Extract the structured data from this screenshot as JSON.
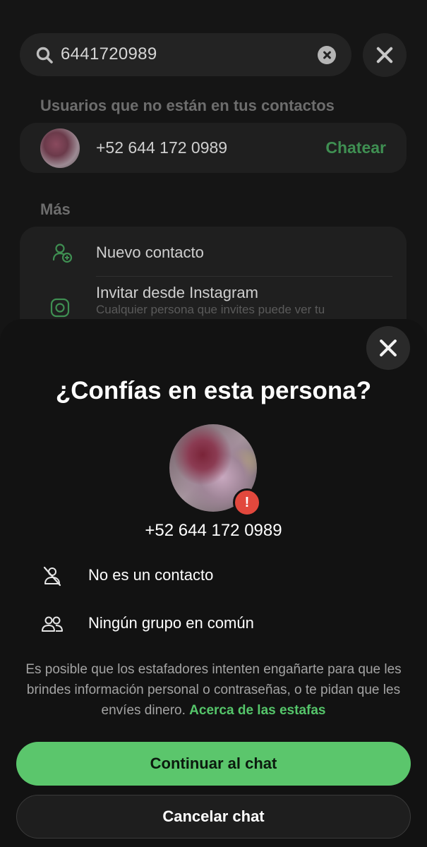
{
  "search": {
    "value": "6441720989"
  },
  "results": {
    "section_title": "Usuarios que no están en tus contactos",
    "contact": {
      "phone": "+52 644 172 0989",
      "action_label": "Chatear"
    }
  },
  "more": {
    "section_title": "Más",
    "items": [
      {
        "label": "Nuevo contacto",
        "icon": "add-contact-icon"
      },
      {
        "label": "Invitar desde Instagram",
        "sublabel": "Cualquier persona que invites puede ver tu",
        "icon": "instagram-icon"
      }
    ]
  },
  "dialog": {
    "title": "¿Confías en esta persona?",
    "phone": "+52 644 172 0989",
    "badge": "!",
    "facts": [
      {
        "label": "No es un contacto",
        "icon": "no-contact-icon"
      },
      {
        "label": "Ningún grupo en común",
        "icon": "group-icon"
      }
    ],
    "warning": "Es posible que los estafadores intenten engañarte para que les brindes información personal o contraseñas, o te pidan que les envíes dinero.",
    "warning_link": "Acerca de las estafas",
    "continue_label": "Continuar al chat",
    "cancel_label": "Cancelar chat"
  },
  "colors": {
    "accent_green": "#5bc66c",
    "link_green": "#55c56a",
    "warning_red": "#e2483d"
  }
}
